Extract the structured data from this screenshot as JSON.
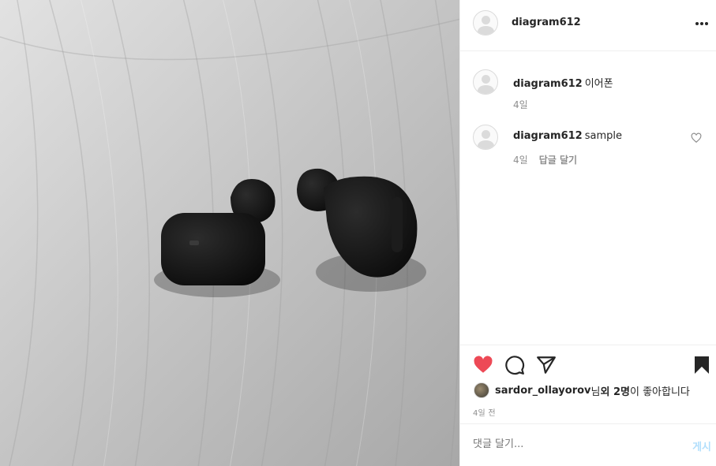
{
  "post": {
    "author": "diagram612",
    "photo_alt": "Two black wireless earbuds on a wooden surface"
  },
  "header": {
    "username": "diagram612",
    "more_icon": "more-horizontal-icon"
  },
  "comments": [
    {
      "username": "diagram612",
      "text": "이어폰",
      "time": "4일",
      "reply_label": ""
    },
    {
      "username": "diagram612",
      "text": "sample",
      "time": "4일",
      "reply_label": "답글 달기"
    }
  ],
  "actions": {
    "like_icon": "heart-filled-icon",
    "comment_icon": "comment-icon",
    "share_icon": "paper-plane-icon",
    "save_icon": "bookmark-icon",
    "like_color": "#ed4956"
  },
  "likes": {
    "liker": "sardor_ollayorov",
    "suffix_1": "님 ",
    "others": "외 2명",
    "suffix_2": "이 좋아합니다"
  },
  "timestamp": "4일 전",
  "add_comment": {
    "placeholder": "댓글 달기...",
    "post_label": "게시"
  }
}
